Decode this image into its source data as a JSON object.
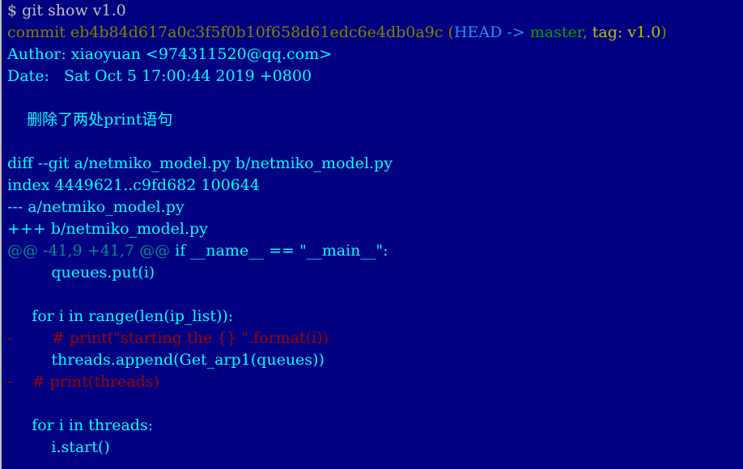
{
  "terminal": {
    "prompt_line": "$ git show v1.0",
    "commit_label": "commit ",
    "commit_hash": "eb4b84d617a0c3f5f0b10f658d61edc6e4db0a9c",
    "ref_open": " (",
    "ref_head": "HEAD -> ",
    "ref_master": "master",
    "ref_sep": ", ",
    "ref_tag": "tag: v1.0",
    "ref_close": ")",
    "author_line": "Author: xiaoyuan <974311520@qq.com>",
    "date_line": "Date:   Sat Oct 5 17:00:44 2019 +0800",
    "message_line": "    删除了两处print语句",
    "diff_line": "diff --git a/netmiko_model.py b/netmiko_model.py",
    "index_line": "index 4449621..c9fd682 100644",
    "minus_file_line": "--- a/netmiko_model.py",
    "plus_file_line": "+++ b/netmiko_model.py",
    "hunk_range": "@@ -41,9 +41,7 @@",
    "hunk_context": " if __name__ == \"__main__\":",
    "ctx_1": "         queues.put(i)",
    "ctx_2": "     for i in range(len(ip_list)):",
    "del_1": "-        # print(\"starting the {} \".format(i))",
    "ctx_3": "         threads.append(Get_arp1(queues))",
    "del_2": "-    # print(threads)",
    "ctx_4": "     for i in threads:",
    "ctx_5": "         i.start()"
  },
  "colors": {
    "background": "#000080",
    "commit": "#808000",
    "head": "#1e90ff",
    "master": "#00a000",
    "tag": "#c0c000",
    "text": "#00ffff",
    "hunk": "#008b8b",
    "deleted": "#a00000"
  }
}
